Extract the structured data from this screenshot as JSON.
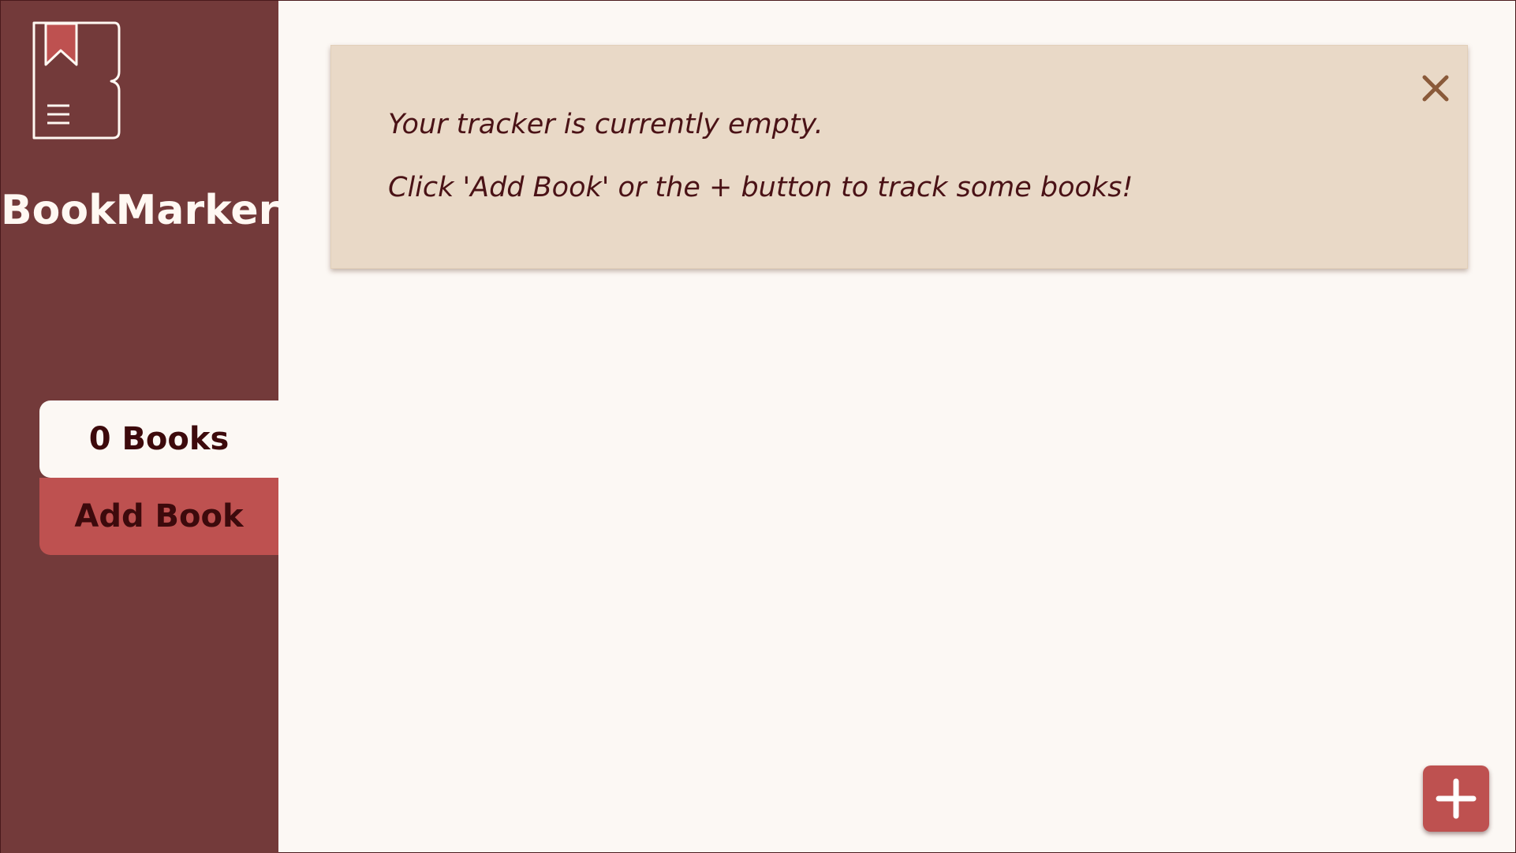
{
  "app": {
    "name": "BookMarker",
    "logo_icon": "bookmark-book-icon"
  },
  "sidebar": {
    "book_count_label": "0 Books",
    "add_book_label": "Add Book"
  },
  "notice": {
    "line1": "Your tracker is currently empty.",
    "line2": "Click 'Add Book' or the + button to track some books!",
    "close_icon": "close-icon"
  },
  "fab": {
    "icon": "plus-icon"
  },
  "colors": {
    "sidebar_bg": "#733a3a",
    "accent": "#be5150",
    "page_bg": "#fcf8f4",
    "notice_bg": "#e9d9c7",
    "text_dark": "#3d0a0c",
    "close_icon": "#8a5a3a"
  }
}
